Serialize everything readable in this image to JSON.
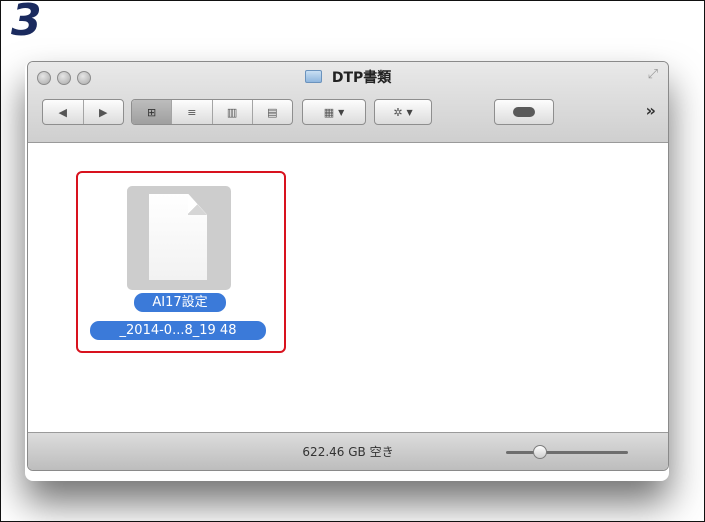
{
  "step": {
    "number": "3"
  },
  "window": {
    "title": "DTP書類"
  },
  "toolbar": {
    "back_icon": "◀",
    "forward_icon": "▶",
    "view_icon": "⊞",
    "list_icon": "≡",
    "columns_icon": "▥",
    "coverflow_icon": "▤",
    "arrange_icon": "▦",
    "action_icon": "✲",
    "more_icon": "»"
  },
  "file": {
    "name_line1": "AI17設定",
    "name_line2": "_2014-0...8_19 48"
  },
  "status": {
    "free_space": "622.46 GB 空き"
  },
  "colors": {
    "selection_border": "#d8121e",
    "label_bg": "#3b7ad9"
  }
}
